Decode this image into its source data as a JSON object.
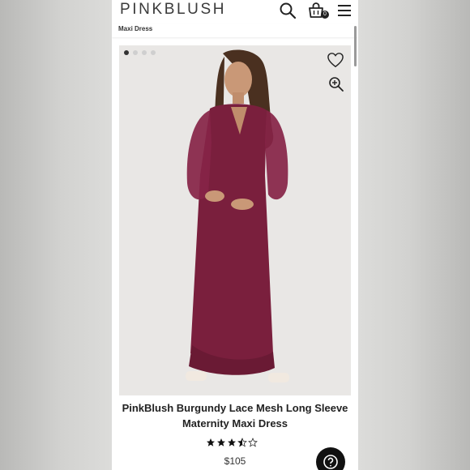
{
  "header": {
    "logo": "PINKBLUSH",
    "cart_count": "0",
    "icons": [
      "search-icon",
      "shopping-bag-icon",
      "menu-icon"
    ]
  },
  "breadcrumb": {
    "label": "Maxi Dress"
  },
  "gallery": {
    "image_count": 4,
    "active_index": 0,
    "icons": [
      "heart-icon",
      "zoom-in-icon"
    ]
  },
  "product": {
    "title_line1": "PinkBlush Burgundy Lace Mesh Long Sleeve",
    "title_line2": "Maternity Maxi Dress",
    "rating": 3.5,
    "rating_max": 5,
    "price": "$105"
  },
  "colors": {
    "dress": "#7a1f3d",
    "background": "#e9e7e5",
    "help_button": "#111111"
  }
}
